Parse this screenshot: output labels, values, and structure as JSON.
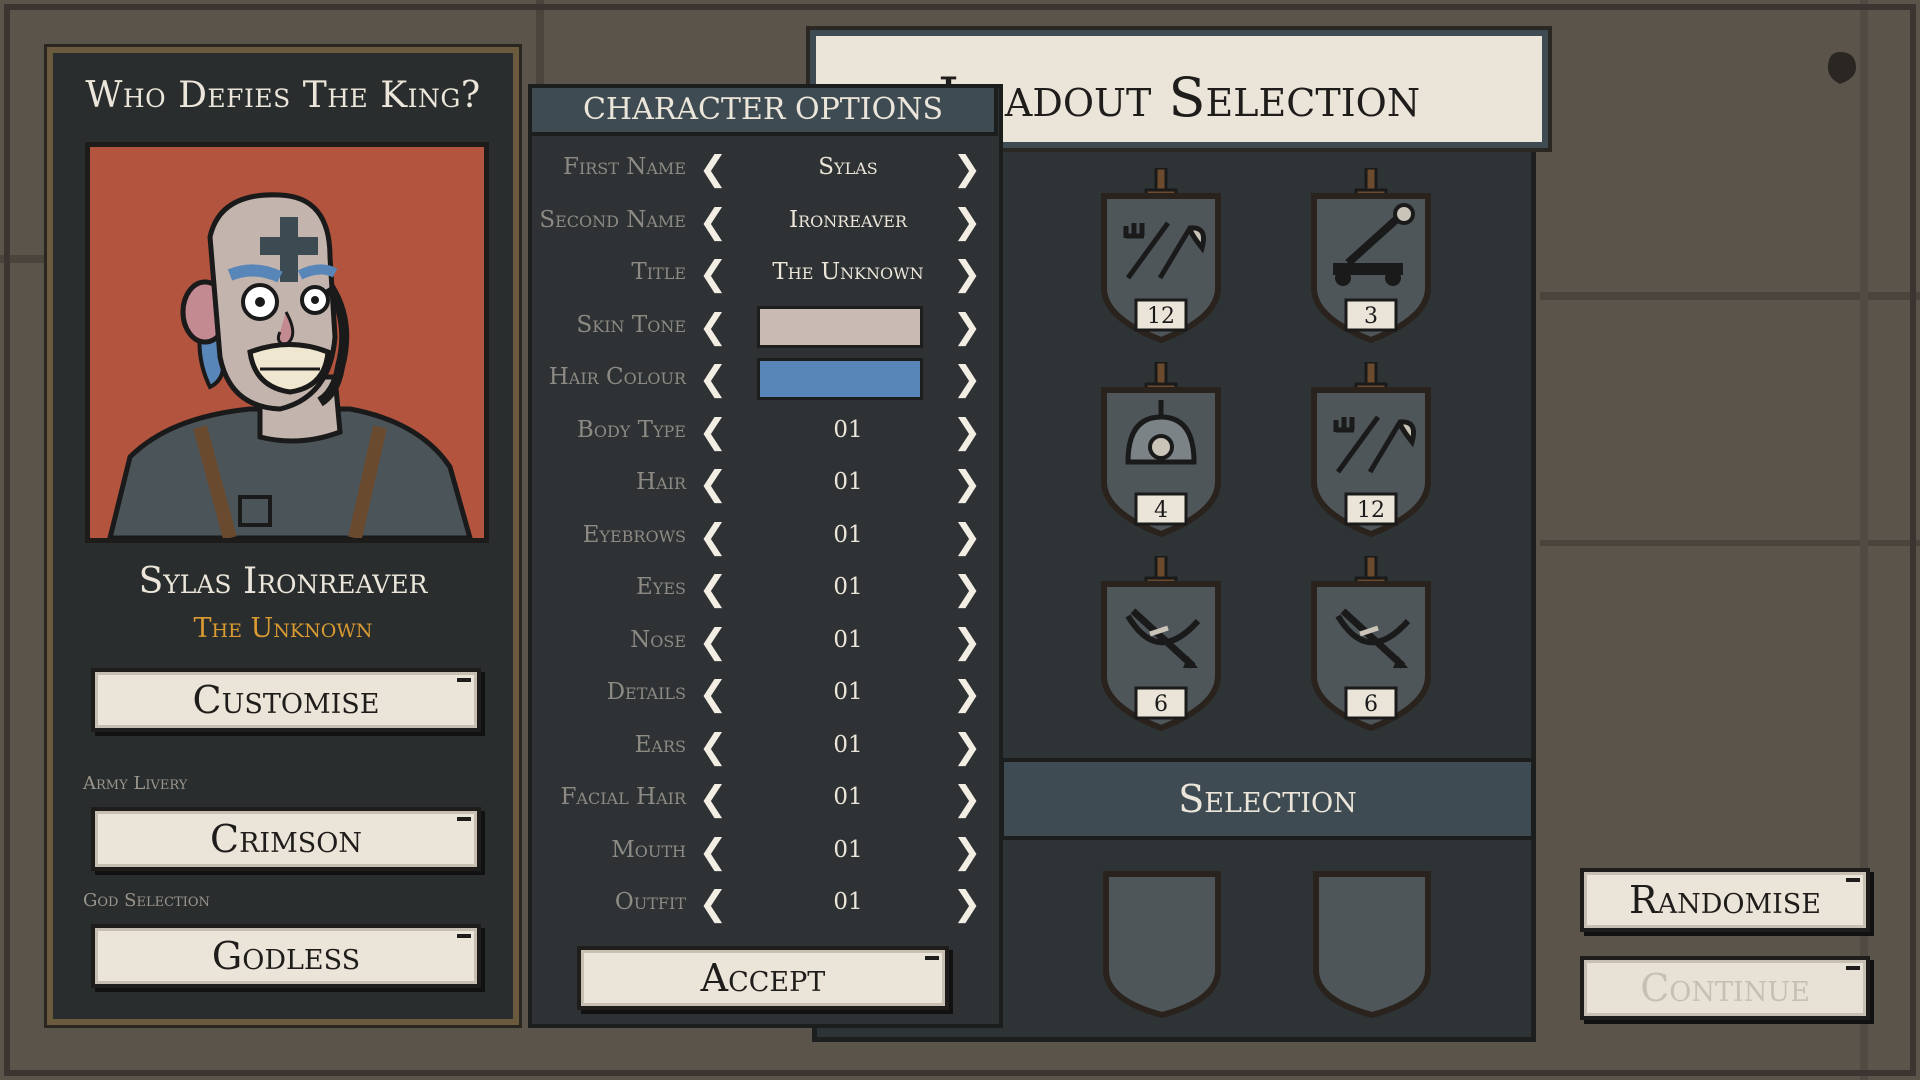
{
  "left_panel": {
    "title": "Who Defies The King?",
    "character_name": "Sylas Ironreaver",
    "character_title": "The Unknown",
    "customise_label": "Customise",
    "army_livery_label": "Army Livery",
    "army_livery_value": "Crimson",
    "god_selection_label": "God Selection",
    "god_selection_value": "Godless"
  },
  "character_options": {
    "header": "CHARACTER OPTIONS",
    "rows": [
      {
        "label": "First Name",
        "value": "Sylas"
      },
      {
        "label": "Second Name",
        "value": "Ironreaver"
      },
      {
        "label": "Title",
        "value": "The Unknown"
      },
      {
        "label": "Skin Tone",
        "color": "#c9bab4"
      },
      {
        "label": "Hair Colour",
        "color": "#5886b9"
      },
      {
        "label": "Body Type",
        "value": "01"
      },
      {
        "label": "Hair",
        "value": "01"
      },
      {
        "label": "Eyebrows",
        "value": "01"
      },
      {
        "label": "Eyes",
        "value": "01"
      },
      {
        "label": "Nose",
        "value": "01"
      },
      {
        "label": "Details",
        "value": "01"
      },
      {
        "label": "Ears",
        "value": "01"
      },
      {
        "label": "Facial Hair",
        "value": "01"
      },
      {
        "label": "Mouth",
        "value": "01"
      },
      {
        "label": "Outfit",
        "value": "01"
      }
    ],
    "accept_label": "Accept"
  },
  "loadout": {
    "title": "Loadout Selection",
    "units": [
      {
        "icon": "pitchfork-scythe-icon",
        "count": "12"
      },
      {
        "icon": "catapult-icon",
        "count": "3"
      },
      {
        "icon": "spiked-helmet-icon",
        "count": "4"
      },
      {
        "icon": "pitchfork-scythe-icon",
        "count": "12"
      },
      {
        "icon": "crossbow-icon",
        "count": "6"
      },
      {
        "icon": "crossbow-icon",
        "count": "6"
      }
    ],
    "selection_label": "Selection"
  },
  "buttons": {
    "randomise_label": "Randomise",
    "continue_label": "Continue"
  },
  "colors": {
    "accent_orange": "#d99a32",
    "panel_dark": "#2e3234",
    "header_slate": "#3f4b53",
    "parchment": "#ebe4d8"
  }
}
